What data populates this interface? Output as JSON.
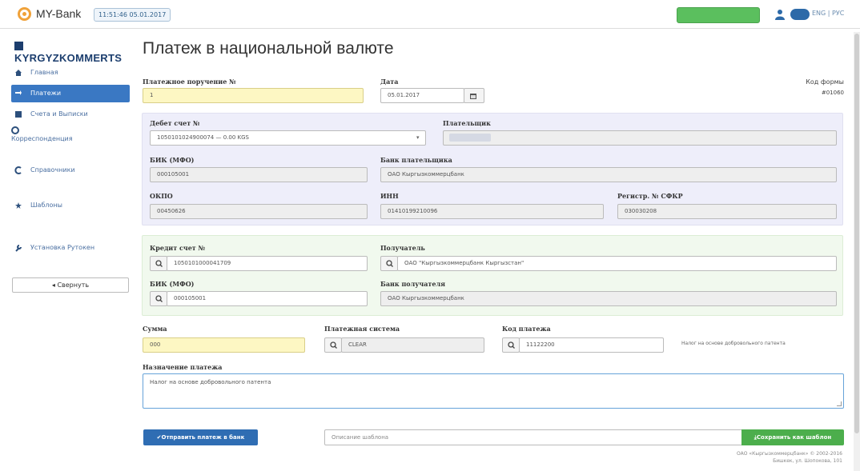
{
  "header": {
    "app_name": "MY-Bank",
    "datetime": "11:51:46 05.01.2017",
    "language": "ENG | РУС"
  },
  "sidebar": {
    "brand": "KYRGYZKOMMERTS",
    "items": [
      {
        "label": "Главная",
        "icon": "home-icon"
      },
      {
        "label": "Платежи",
        "icon": "payments-icon",
        "active": true
      },
      {
        "label": "Счета и Выписки",
        "icon": "accounts-icon"
      },
      {
        "label": "Корреспонденция",
        "icon": "mail-icon"
      },
      {
        "label": "Справочники",
        "icon": "reference-icon"
      },
      {
        "label": "Шаблоны",
        "icon": "star-icon"
      },
      {
        "label": "Установка Рутокен",
        "icon": "wrench-icon"
      }
    ],
    "collapse_label": "◂ Свернуть"
  },
  "page": {
    "title": "Платеж в национальной валюте"
  },
  "form": {
    "order_no_label": "Платежное поручение №",
    "order_no_value": "1",
    "date_label": "Дата",
    "date_value": "05.01.2017",
    "form_code_label": "Код формы",
    "form_code_value": "#01060",
    "debit_account_label": "Дебет счет №",
    "debit_account_value": "1050101024900074 — 0.00 KGS",
    "payer_label": "Плательщик",
    "bik_label": "БИК (МФО)",
    "bik_value": "000105001",
    "payer_bank_label": "Банк плательщика",
    "payer_bank_value": "ОАО Кыргызкоммерцбанк",
    "okpo_label": "ОКПО",
    "okpo_value": "00450626",
    "inn_label": "ИНН",
    "inn_value": "01410199210096",
    "sfkr_label": "Регистр. № СФКР",
    "sfkr_value": "030030208",
    "credit_account_label": "Кредит счет №",
    "credit_account_value": "1050101000041709",
    "recipient_label": "Получатель",
    "recipient_value": "ОАО \"Кыргызкоммерцбанк Кыргызстан\"",
    "credit_bik_label": "БИК (МФО)",
    "credit_bik_value": "000105001",
    "recipient_bank_label": "Банк получателя",
    "recipient_bank_value": "ОАО Кыргызкоммерцбанк",
    "amount_label": "Сумма",
    "amount_value": "000",
    "payment_system_label": "Платежная система",
    "payment_system_value": "CLEAR",
    "payment_code_label": "Код платежа",
    "payment_code_value": "11122200",
    "payment_code_hint": "Налог на основе добровольного патента",
    "purpose_label": "Назначение платежа",
    "purpose_value": "Налог на основе добровольного патента"
  },
  "actions": {
    "send_label": "✔Отправить платеж в банк",
    "template_placeholder": "Описание шаблона",
    "save_template_label": "Сохранить как шаблон"
  },
  "footer": {
    "line1": "ОАО «Кыргызкоммерцбанк» © 2002-2016",
    "line2": "Бишкек, ул. Шопокова, 101"
  },
  "colors": {
    "accent": "#3a78c3",
    "success": "#4cae4c",
    "highlight": "#fdf7c3"
  }
}
